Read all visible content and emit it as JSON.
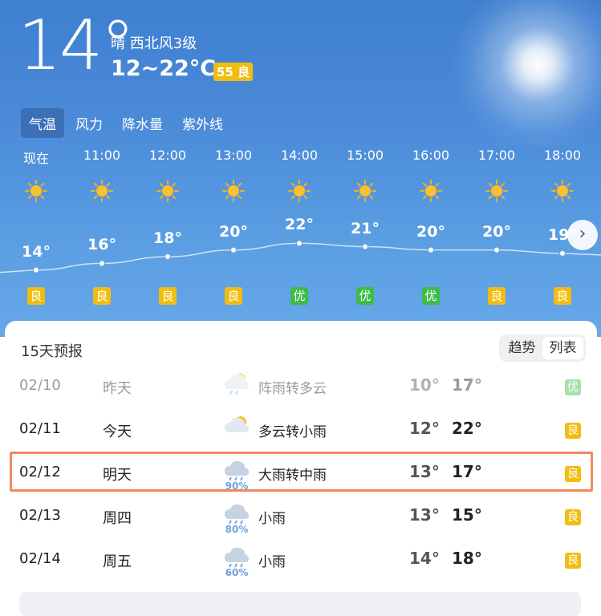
{
  "current": {
    "temp": "14°",
    "condition": "晴  西北风3级",
    "range": "12~22°C",
    "aqi": "55 良"
  },
  "tabs": [
    "气温",
    "风力",
    "降水量",
    "紫外线"
  ],
  "hourly": [
    {
      "time": "现在",
      "temp": "14°",
      "temp_value": 14,
      "quality": "良",
      "quality_color": "#f1bd11"
    },
    {
      "time": "11:00",
      "temp": "16°",
      "temp_value": 16,
      "quality": "良",
      "quality_color": "#f1bd11"
    },
    {
      "time": "12:00",
      "temp": "18°",
      "temp_value": 18,
      "quality": "良",
      "quality_color": "#f1bd11"
    },
    {
      "time": "13:00",
      "temp": "20°",
      "temp_value": 20,
      "quality": "良",
      "quality_color": "#f1bd11"
    },
    {
      "time": "14:00",
      "temp": "22°",
      "temp_value": 22,
      "quality": "优",
      "quality_color": "#3dbb4b"
    },
    {
      "time": "15:00",
      "temp": "21°",
      "temp_value": 21,
      "quality": "优",
      "quality_color": "#3dbb4b"
    },
    {
      "time": "16:00",
      "temp": "20°",
      "temp_value": 20,
      "quality": "优",
      "quality_color": "#3dbb4b"
    },
    {
      "time": "17:00",
      "temp": "20°",
      "temp_value": 20,
      "quality": "良",
      "quality_color": "#f1bd11"
    },
    {
      "time": "18:00",
      "temp": "19°",
      "temp_value": 19,
      "quality": "良",
      "quality_color": "#f1bd11"
    }
  ],
  "forecast": {
    "title": "15天预报",
    "toggle": [
      "趋势",
      "列表"
    ],
    "rows": [
      {
        "date": "02/10",
        "day": "昨天",
        "icon": "shower-to-cloudy-icon",
        "condition": "阵雨转多云",
        "low": "10°",
        "high": "17°",
        "quality": "优",
        "quality_color": "#3dbb4b",
        "precip": ""
      },
      {
        "date": "02/11",
        "day": "今天",
        "icon": "cloudy-to-rain-icon",
        "condition": "多云转小雨",
        "low": "12°",
        "high": "22°",
        "quality": "良",
        "quality_color": "#f1bd11",
        "precip": ""
      },
      {
        "date": "02/12",
        "day": "明天",
        "icon": "heavy-rain-icon",
        "condition": "大雨转中雨",
        "low": "13°",
        "high": "17°",
        "quality": "良",
        "quality_color": "#f1bd11",
        "precip": "90%"
      },
      {
        "date": "02/13",
        "day": "周四",
        "icon": "light-rain-icon",
        "condition": "小雨",
        "low": "13°",
        "high": "15°",
        "quality": "良",
        "quality_color": "#f1bd11",
        "precip": "80%"
      },
      {
        "date": "02/14",
        "day": "周五",
        "icon": "light-rain-icon",
        "condition": "小雨",
        "low": "14°",
        "high": "18°",
        "quality": "良",
        "quality_color": "#f1bd11",
        "precip": "60%"
      }
    ]
  },
  "colors": {
    "good": "#f1bd11",
    "excellent": "#3dbb4b",
    "highlight": "#f08a5d"
  }
}
